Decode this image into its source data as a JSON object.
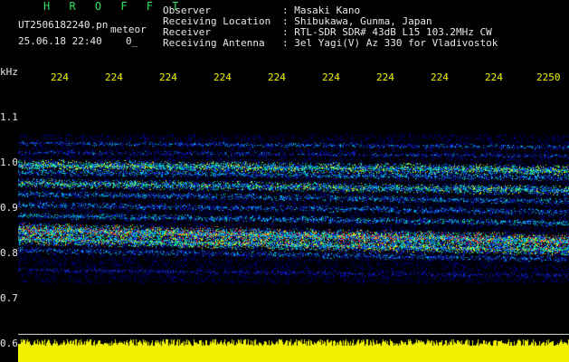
{
  "header": {
    "app_title": "H R O F F T",
    "filename": "UT2506182240.pn",
    "datetime": "25.06.18 22:40",
    "mode_label": "meteor",
    "count": "0_",
    "fields": [
      {
        "label": "Observer",
        "value": ": Masaki Kano"
      },
      {
        "label": "Receiving Location",
        "value": ": Shibukawa, Gunma, Japan"
      },
      {
        "label": "Receiver",
        "value": ": RTL-SDR SDR# 43dB L15 103.2MHz CW"
      },
      {
        "label": "Receiving Antenna",
        "value": ": 3el Yagi(V) Az 330 for Vladivostok"
      }
    ]
  },
  "y_axis": {
    "unit": "kHz",
    "ticks": [
      "1.1",
      "1.0",
      "0.9",
      "0.8",
      "0.7",
      "0.6"
    ]
  },
  "x_axis": {
    "ticks": [
      "224",
      "224",
      "224",
      "224",
      "224",
      "224",
      "224",
      "224",
      "224",
      "2250"
    ]
  },
  "colors": {
    "background": "#000000",
    "header_green": "#2fe060",
    "axis_yellow": "#f2f200",
    "signal_bar": "#f2f200",
    "spectrum_low": "#1020a0",
    "spectrum_high": "#ff2010"
  }
}
